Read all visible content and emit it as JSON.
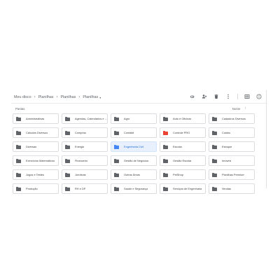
{
  "breadcrumb": {
    "root": "Meu disco",
    "items": [
      "Planilhas",
      "Planilhas",
      "Planilhas"
    ]
  },
  "toolbar": {
    "icons": [
      "link-icon",
      "add-person-icon",
      "trash-icon",
      "more-vert-icon",
      "grid-view-icon",
      "info-icon"
    ]
  },
  "section": {
    "title": "Pastas"
  },
  "sort": {
    "label": "Nome",
    "direction": "↑"
  },
  "colors": {
    "folder_default": "#5f6368",
    "folder_blue": "#4285f4",
    "folder_red": "#ea4335",
    "selected_bg": "#e8f0fe"
  },
  "folders": [
    {
      "name": "Administrativas",
      "color": "default"
    },
    {
      "name": "Agendas, Calendários e ...",
      "color": "default"
    },
    {
      "name": "Agro",
      "color": "default"
    },
    {
      "name": "Auto e Oficinas",
      "color": "default"
    },
    {
      "name": "Cadastros Diversos",
      "color": "default"
    },
    {
      "name": "Cálculos Diversos",
      "color": "default"
    },
    {
      "name": "Compras",
      "color": "default"
    },
    {
      "name": "Contábil",
      "color": "default"
    },
    {
      "name": "Controle PRO",
      "color": "red"
    },
    {
      "name": "Custos",
      "color": "default"
    },
    {
      "name": "Diversas",
      "color": "default"
    },
    {
      "name": "Energia",
      "color": "default"
    },
    {
      "name": "Engenharia Civil",
      "color": "blue",
      "selected": true
    },
    {
      "name": "Escolar",
      "color": "default"
    },
    {
      "name": "Estoque",
      "color": "default"
    },
    {
      "name": "Exercícios Matemáticos",
      "color": "default"
    },
    {
      "name": "Financeiro",
      "color": "default"
    },
    {
      "name": "Gestão de Negócios",
      "color": "default"
    },
    {
      "name": "Gestão Escolar",
      "color": "default"
    },
    {
      "name": "Imóveis",
      "color": "default"
    },
    {
      "name": "Jogos e Testes",
      "color": "default"
    },
    {
      "name": "Jurídicas",
      "color": "default"
    },
    {
      "name": "Outras Áreas",
      "color": "default"
    },
    {
      "name": "PetShop",
      "color": "default"
    },
    {
      "name": "Planilhas Premium",
      "color": "default"
    },
    {
      "name": "Produção",
      "color": "default"
    },
    {
      "name": "RH e DP",
      "color": "default"
    },
    {
      "name": "Saúde e Segurança",
      "color": "default"
    },
    {
      "name": "Serviços de Engenharia",
      "color": "default"
    },
    {
      "name": "Vendas",
      "color": "default"
    }
  ]
}
